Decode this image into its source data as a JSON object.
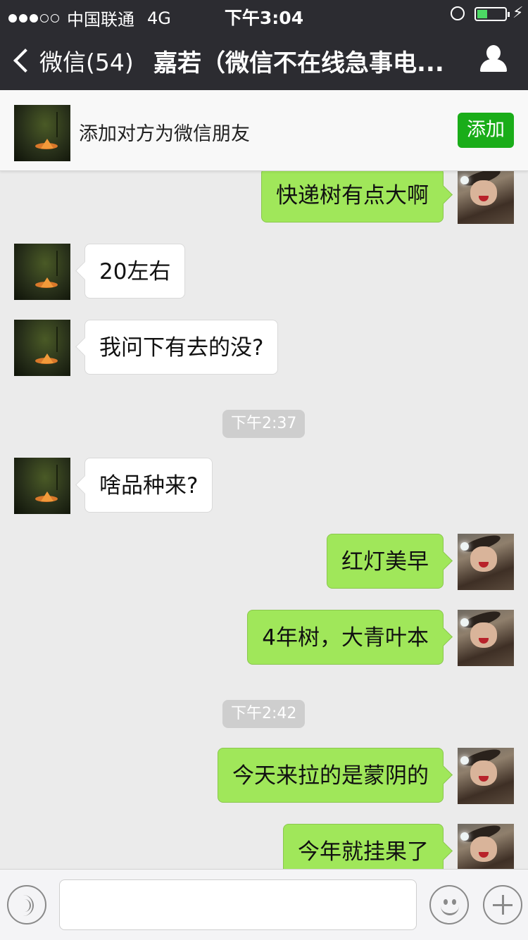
{
  "status": {
    "carrier": "中国联通",
    "network": "4G",
    "time": "下午3:04"
  },
  "nav": {
    "back_label": "微信(54)",
    "title": "嘉若（微信不在线急事电..."
  },
  "add_friend": {
    "text": "添加对方为微信朋友",
    "button": "添加"
  },
  "messages": [
    {
      "side": "out",
      "text": "快递树有点大啊"
    },
    {
      "side": "in",
      "text": "20左右"
    },
    {
      "side": "in",
      "text": "我问下有去的没?"
    },
    {
      "side": "time",
      "text": "下午2:37"
    },
    {
      "side": "in",
      "text": "啥品种来?"
    },
    {
      "side": "out",
      "text": "红灯美早"
    },
    {
      "side": "out",
      "text": "4年树，大青叶本"
    },
    {
      "side": "time",
      "text": "下午2:42"
    },
    {
      "side": "out",
      "text": "今天来拉的是蒙阴的"
    },
    {
      "side": "out",
      "text": "今年就挂果了"
    }
  ],
  "input": {
    "value": "",
    "placeholder": ""
  },
  "icons": {
    "voice": "voice-icon",
    "emoji": "emoji-icon",
    "more": "plus-icon",
    "contact": "person-icon"
  },
  "colors": {
    "accent_green": "#1aad19",
    "outgoing_bubble": "#a0e75a",
    "nav_bg": "#2c2c31"
  }
}
